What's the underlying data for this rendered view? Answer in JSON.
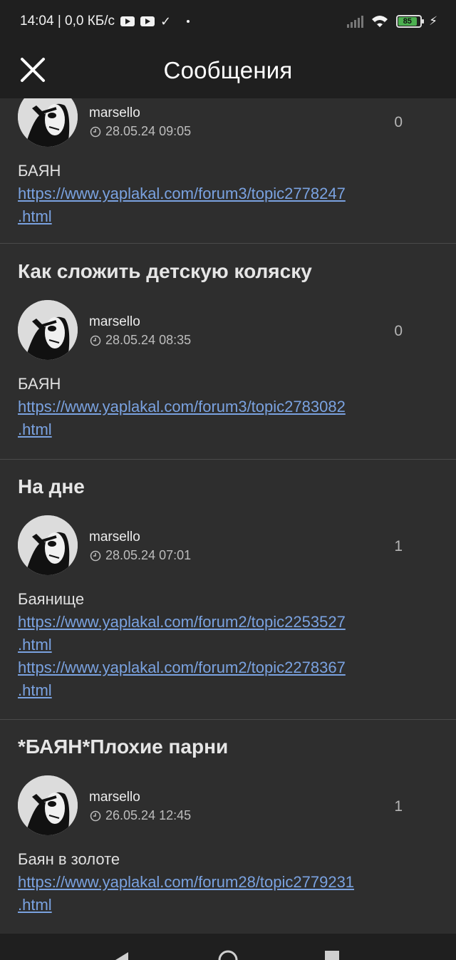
{
  "status_bar": {
    "time_info": "14:04 | 0,0 КБ/с",
    "battery_level": "85"
  },
  "app_bar": {
    "title": "Сообщения"
  },
  "posts": [
    {
      "title": "",
      "author": "marsello",
      "date": "28.05.24 09:05",
      "count": "0",
      "text": "БАЯН",
      "links": [
        "https://www.yaplakal.com/forum3/topic2778247",
        ".html"
      ]
    },
    {
      "title": "Как сложить детскую коляску",
      "author": "marsello",
      "date": "28.05.24 08:35",
      "count": "0",
      "text": "БАЯН",
      "links": [
        "https://www.yaplakal.com/forum3/topic2783082",
        ".html"
      ]
    },
    {
      "title": "На дне",
      "author": "marsello",
      "date": "28.05.24 07:01",
      "count": "1",
      "text": "Баянище",
      "links": [
        "https://www.yaplakal.com/forum2/topic2253527",
        ".html",
        "https://www.yaplakal.com/forum2/topic2278367",
        ".html"
      ]
    },
    {
      "title": "*БАЯН*Плохие парни",
      "author": "marsello",
      "date": "26.05.24 12:45",
      "count": "1",
      "text": "Баян в золоте",
      "links": [
        "https://www.yaplakal.com/forum28/topic2779231",
        ".html"
      ]
    }
  ],
  "colors": {
    "background": "#2e2e2e",
    "bar": "#1f1f1f",
    "link": "#7aa2e0",
    "battery": "#4caf50"
  }
}
